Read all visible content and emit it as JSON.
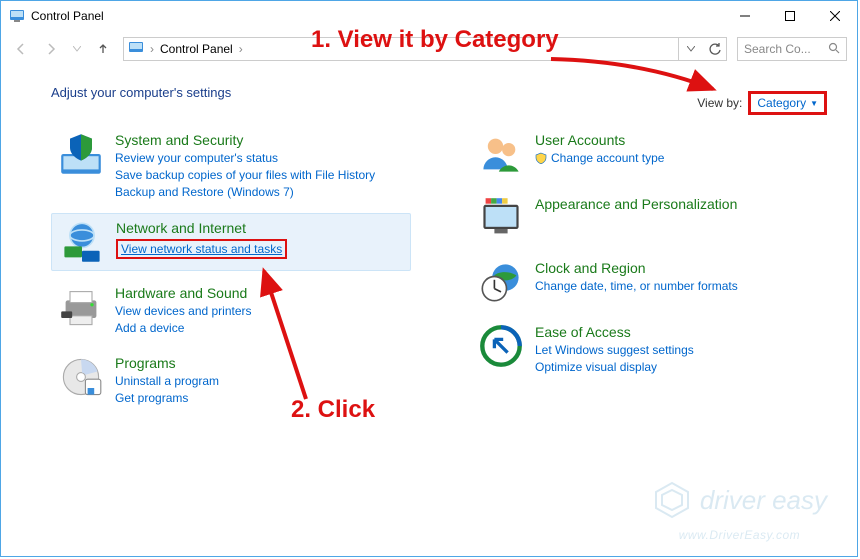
{
  "window": {
    "title": "Control Panel"
  },
  "breadcrumb": {
    "root": "Control Panel"
  },
  "search": {
    "placeholder": "Search Co..."
  },
  "heading": "Adjust your computer's settings",
  "viewby": {
    "label": "View by:",
    "value": "Category"
  },
  "annotations": {
    "step1": "1. View it by Category",
    "step2": "2. Click"
  },
  "left": [
    {
      "title": "System and Security",
      "links": [
        "Review your computer's status",
        "Save backup copies of your files with File History",
        "Backup and Restore (Windows 7)"
      ]
    },
    {
      "title": "Network and Internet",
      "links": [
        "View network status and tasks"
      ],
      "highlight": true
    },
    {
      "title": "Hardware and Sound",
      "links": [
        "View devices and printers",
        "Add a device"
      ]
    },
    {
      "title": "Programs",
      "links": [
        "Uninstall a program",
        "Get programs"
      ]
    }
  ],
  "right": [
    {
      "title": "User Accounts",
      "links": [
        "Change account type"
      ],
      "shield": true
    },
    {
      "title": "Appearance and Personalization",
      "links": []
    },
    {
      "title": "Clock and Region",
      "links": [
        "Change date, time, or number formats"
      ]
    },
    {
      "title": "Ease of Access",
      "links": [
        "Let Windows suggest settings",
        "Optimize visual display"
      ]
    }
  ],
  "watermark": {
    "brand": "driver easy",
    "url": "www.DriverEasy.com"
  }
}
